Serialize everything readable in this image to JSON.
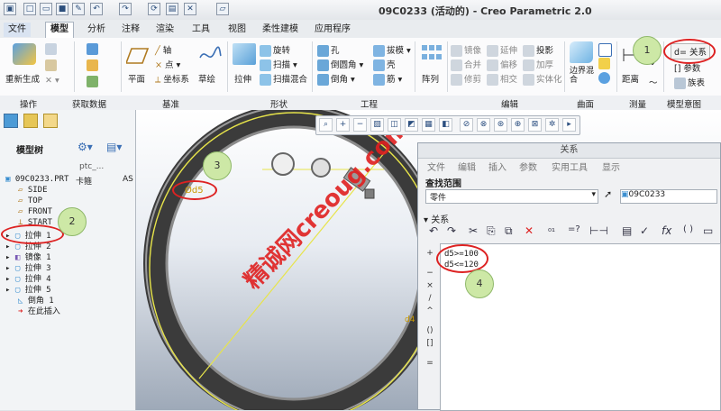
{
  "window": {
    "title": "09C0233 (活动的) - Creo Parametric 2.0"
  },
  "menu_tabs": [
    "文件",
    "模型",
    "分析",
    "注释",
    "渲染",
    "工具",
    "视图",
    "柔性建模",
    "应用程序"
  ],
  "active_tab": "模型",
  "ribbon": {
    "operations": {
      "regenerate": "重新生成"
    },
    "get_data": {},
    "datum": {
      "plane": "平面",
      "axis": "轴",
      "point": "点",
      "csys": "坐标系",
      "sketch": "草绘"
    },
    "shapes": {
      "extrude": "拉伸",
      "revolve": "旋转",
      "sweep": "扫描",
      "swept_blend": "扫描混合"
    },
    "engineering": {
      "hole": "孔",
      "round": "倒圆角",
      "chamfer": "倒角",
      "draft": "拔模",
      "shell": "壳",
      "rib": "筋"
    },
    "pattern": "阵列",
    "editing": {
      "mirror": "镜像",
      "extend": "延伸",
      "project": "投影",
      "merge": "合并",
      "offset": "偏移",
      "thicken": "加厚",
      "trim": "修剪",
      "intersect": "相交",
      "solidify": "实体化"
    },
    "surfaces": {
      "boundary_blend": "边界混合"
    },
    "measure": {
      "distance": "距离"
    },
    "model_intent": {
      "relations": "d= 关系",
      "parameters": "[] 参数",
      "family_table": "族表"
    },
    "groups": [
      "操作",
      "获取数据",
      "基准",
      "形状",
      "工程",
      "编辑",
      "曲面",
      "测量",
      "模型意图"
    ]
  },
  "model_tree": {
    "header": "模型树",
    "columns": [
      "ptc_...",
      "卡箍"
    ],
    "col2_value": "AS",
    "items": [
      {
        "label": "09C0233.PRT"
      },
      {
        "label": "SIDE"
      },
      {
        "label": "TOP"
      },
      {
        "label": "FRONT"
      },
      {
        "label": "START"
      },
      {
        "label": "拉伸 1"
      },
      {
        "label": "拉伸 2"
      },
      {
        "label": "镜像 1"
      },
      {
        "label": "拉伸 3"
      },
      {
        "label": "拉伸 4"
      },
      {
        "label": "拉伸 5"
      },
      {
        "label": "倒角 1"
      },
      {
        "label": "在此插入"
      }
    ]
  },
  "graphics": {
    "dimension_d5": "Ød5",
    "dimension_d4": "d4",
    "watermark": "精诚网creoug.com"
  },
  "relations_dialog": {
    "title": "关系",
    "menu": [
      "文件",
      "编辑",
      "插入",
      "参数",
      "实用工具",
      "显示"
    ],
    "lookup_label": "查找范围",
    "lookup_value": "零件",
    "lookup_target": "09C0233",
    "section_label": "关系",
    "relations": [
      "d5>=100",
      "d5<=120"
    ],
    "fx_label": "fx"
  },
  "callouts": [
    "1",
    "2",
    "3",
    "4"
  ],
  "colors": {
    "ribbon_bg": "#fbfbfc",
    "callout_fill": "#cde8a6",
    "highlight_red": "#dd2222",
    "watermark_red": "#e02020",
    "ring_dark": "#3b3b3b"
  }
}
